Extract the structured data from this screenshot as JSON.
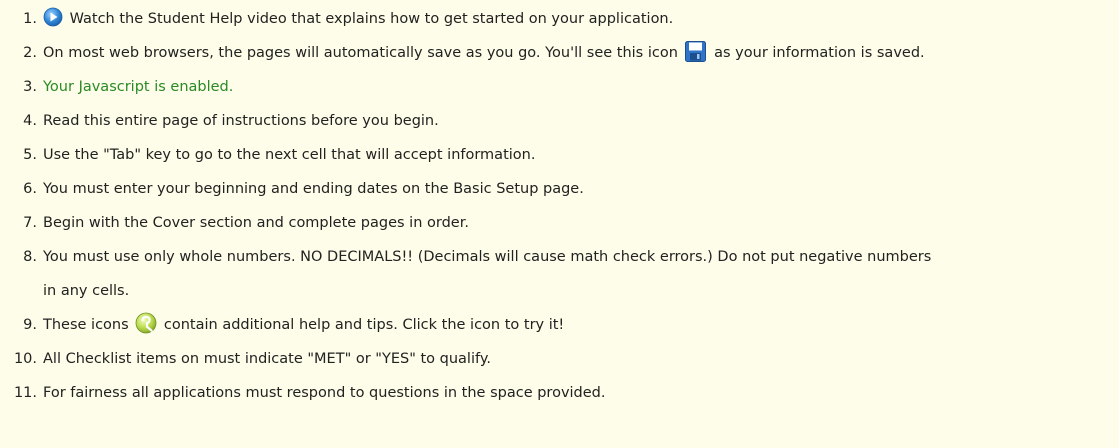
{
  "items": [
    {
      "number": "1.",
      "icon_before": "play-video-icon",
      "text": "Watch the Student Help video that explains how to get started on your application."
    },
    {
      "number": "2.",
      "text_before": "On most web browsers, the pages will automatically save as you go. You'll see this icon",
      "icon": "save-disk-icon",
      "text_after": "as your information is saved."
    },
    {
      "number": "3.",
      "text": "Your Javascript is enabled.",
      "color": "#2a8a25"
    },
    {
      "number": "4.",
      "text": "Read this entire page of instructions before you begin."
    },
    {
      "number": "5.",
      "text": "Use the \"Tab\" key to go to the next cell that will accept information."
    },
    {
      "number": "6.",
      "text": "You must enter your beginning and ending dates on the Basic Setup page."
    },
    {
      "number": "7.",
      "text": "Begin with the Cover section and complete pages in order."
    },
    {
      "number": "8.",
      "text_line1": "You must use only whole numbers. NO DECIMALS!! (Decimals will cause math check errors.) Do not put negative numbers",
      "text_line2": "in any cells."
    },
    {
      "number": "9.",
      "text_before": "These icons",
      "icon": "help-question-icon",
      "text_after": "contain additional help and tips. Click the icon to try it!"
    },
    {
      "number": "10.",
      "text": "All Checklist items on must indicate \"MET\" or \"YES\" to qualify."
    },
    {
      "number": "11.",
      "text": "For fairness all applications must respond to questions in the space provided."
    }
  ],
  "colors": {
    "background": "#fdfde9",
    "text": "#222222",
    "success": "#2a8a25",
    "icon_blue": "#2f86d6"
  }
}
